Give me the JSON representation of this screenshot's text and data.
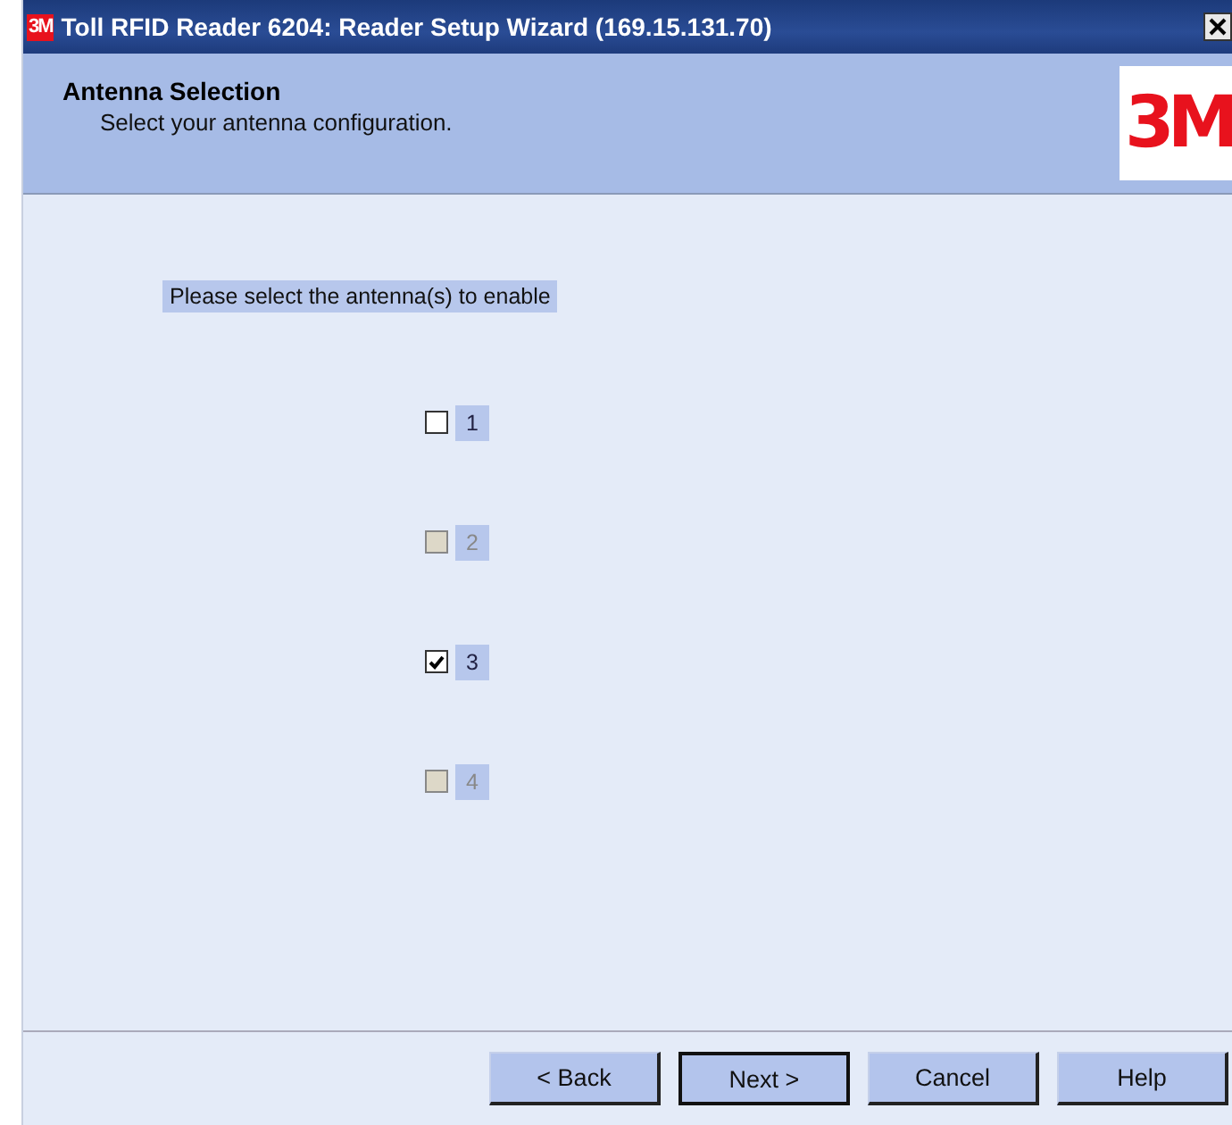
{
  "window": {
    "logo": "3M",
    "title": "Toll RFID Reader 6204: Reader Setup Wizard (169.15.131.70)"
  },
  "header": {
    "title": "Antenna Selection",
    "subtitle": "Select your antenna configuration.",
    "logo": "3M"
  },
  "instruction": "Please select the antenna(s) to enable",
  "antennas": [
    {
      "label": "1",
      "checked": false,
      "disabled": false
    },
    {
      "label": "2",
      "checked": false,
      "disabled": true
    },
    {
      "label": "3",
      "checked": true,
      "disabled": false
    },
    {
      "label": "4",
      "checked": false,
      "disabled": true
    }
  ],
  "buttons": [
    {
      "label": "< Back",
      "default": false
    },
    {
      "label": "Next >",
      "default": true
    },
    {
      "label": "Cancel",
      "default": false
    },
    {
      "label": "Help",
      "default": false
    }
  ]
}
